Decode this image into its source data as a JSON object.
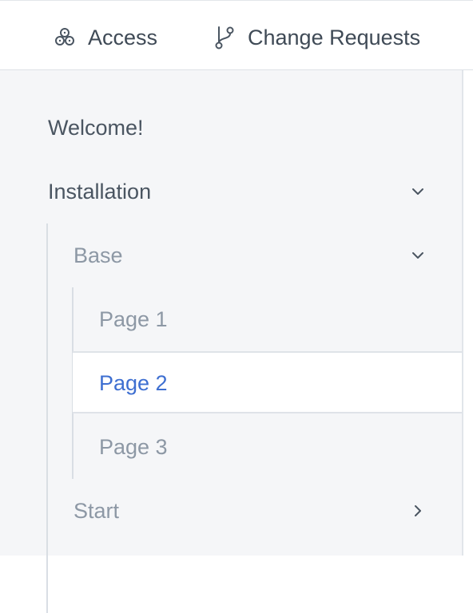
{
  "topbar": {
    "tabs": [
      {
        "label": "Access",
        "icon": "access-icon"
      },
      {
        "label": "Change Requests",
        "icon": "branch-icon"
      }
    ]
  },
  "sidebar": {
    "items": [
      {
        "label": "Welcome!"
      },
      {
        "label": "Installation",
        "expanded": true
      },
      {
        "label": "Base",
        "expanded": true
      },
      {
        "label": "Page 1"
      },
      {
        "label": "Page 2",
        "active": true
      },
      {
        "label": "Page 3"
      },
      {
        "label": "Start",
        "expanded": false
      }
    ]
  },
  "colors": {
    "active_text": "#3e6fd1",
    "sidebar_bg": "#f5f6f8",
    "muted_text": "#8d98a5",
    "primary_text": "#4a5561"
  }
}
